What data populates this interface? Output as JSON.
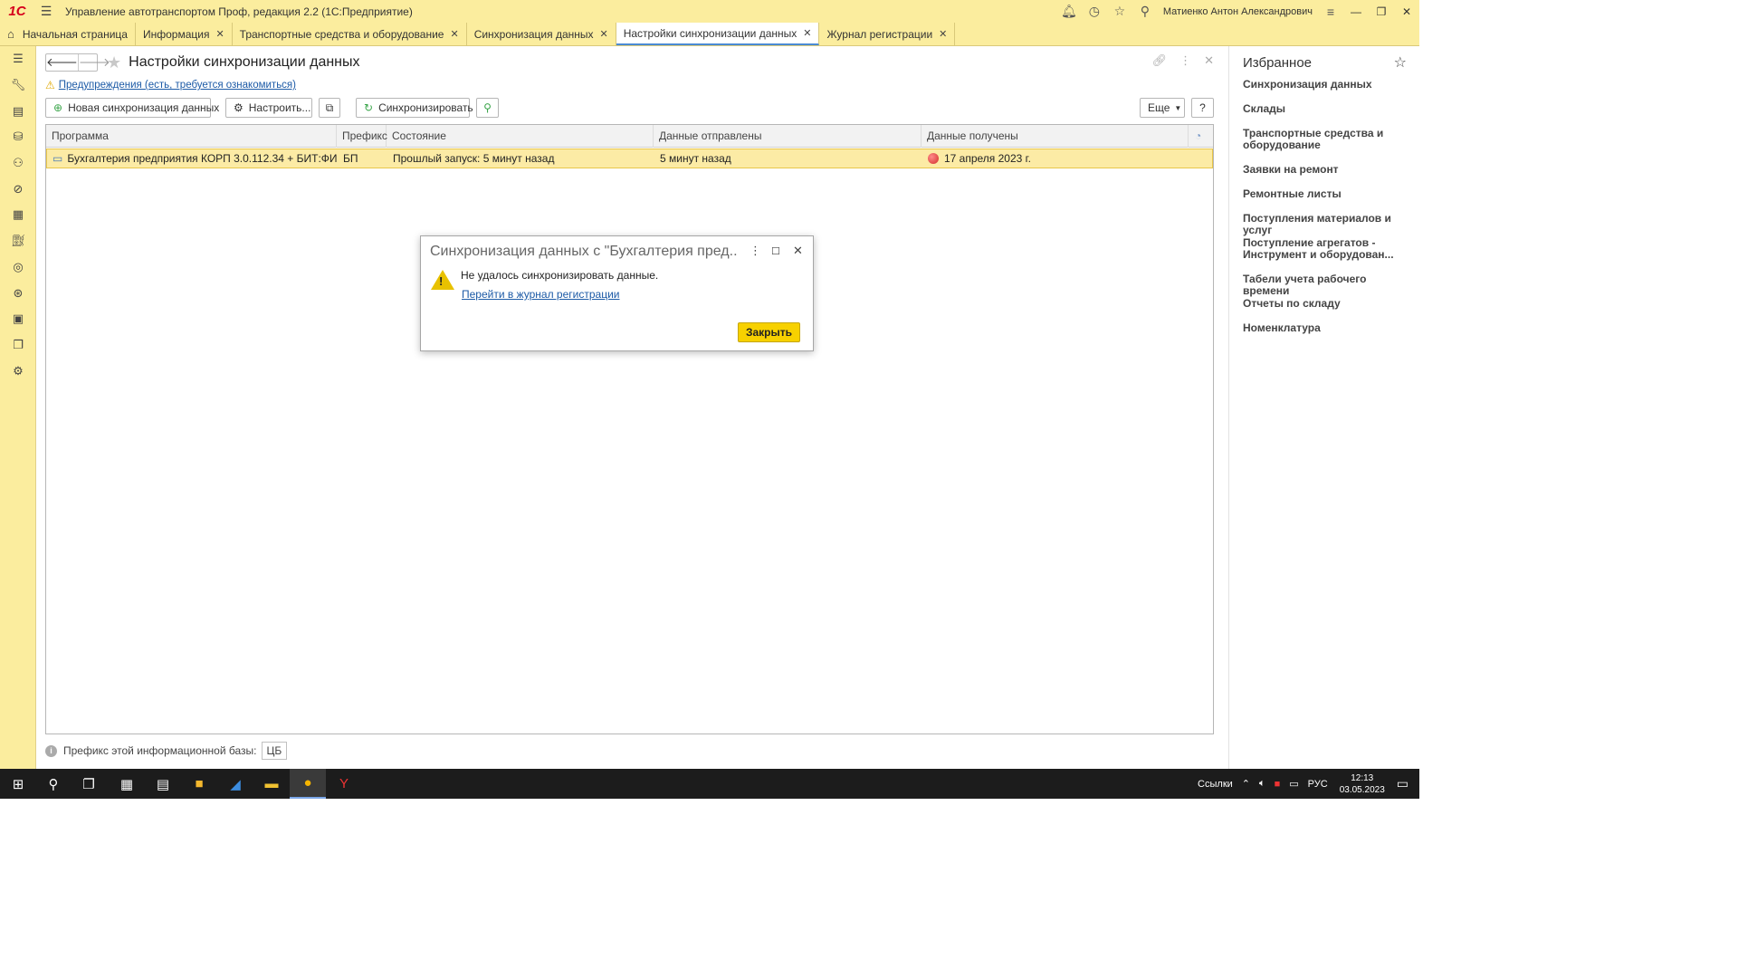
{
  "app": {
    "title": "Управление автотранспортом Проф, редакция 2.2  (1С:Предприятие)",
    "logo": "1С",
    "user": "Матиенко Антон Александрович"
  },
  "tabs": [
    {
      "label": "Начальная страница"
    },
    {
      "label": "Информация"
    },
    {
      "label": "Транспортные средства и оборудование"
    },
    {
      "label": "Синхронизация данных"
    },
    {
      "label": "Настройки синхронизации данных"
    },
    {
      "label": "Журнал регистрации"
    }
  ],
  "page": {
    "title": "Настройки синхронизации данных",
    "warning_link": "Предупреждения (есть, требуется ознакомиться)"
  },
  "toolbar": {
    "new_sync": "Новая синхронизация данных",
    "configure": "Настроить...",
    "synchronize": "Синхронизировать",
    "more": "Еще",
    "help": "?"
  },
  "table": {
    "columns": [
      "Программа",
      "Префикс",
      "Состояние",
      "Данные отправлены",
      "Данные получены"
    ],
    "rows": [
      {
        "program": "Бухгалтерия предприятия КОРП 3.0.112.34 + БИТ:ФИН...",
        "prefix": "БП",
        "state": "Прошлый запуск: 5 минут назад",
        "sent": "5 минут назад",
        "received": "17 апреля 2023 г."
      }
    ]
  },
  "footer": {
    "prefix_label": "Префикс этой информационной базы:",
    "prefix_value": "ЦБ"
  },
  "dialog": {
    "title": "Синхронизация данных с \"Бухгалтерия пред...",
    "message": "Не удалось синхронизировать данные.",
    "link": "Перейти в журнал регистрации",
    "close_button": "Закрыть"
  },
  "favorites": {
    "title": "Избранное",
    "items": [
      "Синхронизация данных",
      "Склады",
      "Транспортные средства и оборудование",
      "Заявки на ремонт",
      "Ремонтные листы",
      "Поступления материалов и услуг",
      "Поступление агрегатов - Инструмент и оборудован...",
      "Табели учета рабочего времени",
      "Отчеты по складу",
      "Номенклатура"
    ]
  },
  "taskbar": {
    "links_label": "Ссылки",
    "lang": "РУС",
    "time": "12:13",
    "date": "03.05.2023"
  },
  "colors": {
    "panel": "#FBED9E",
    "selected_row": "#FCEBA5",
    "primary_button": "#F7D100",
    "link": "#1C5AA6"
  }
}
